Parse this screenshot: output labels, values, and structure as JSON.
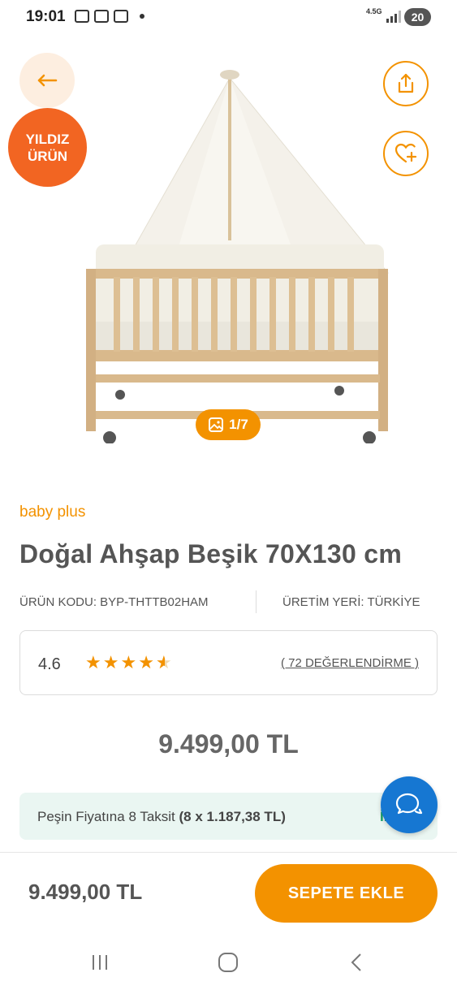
{
  "status_bar": {
    "time": "19:01",
    "network": "4.5G",
    "battery": "20",
    "icons": [
      "pdf-icon",
      "screenshot-icon",
      "box-icon"
    ]
  },
  "hero": {
    "badge_line1": "YILDIZ",
    "badge_line2": "ÜRÜN",
    "gallery_counter": "1/7",
    "icons": {
      "back": "arrow-left-icon",
      "share": "share-icon",
      "favorite": "heart-plus-icon",
      "gallery": "image-icon"
    }
  },
  "product": {
    "brand": "baby plus",
    "title": "Doğal Ahşap Beşik 70X130 cm",
    "code": "ÜRÜN KODU: BYP-THTTB02HAM",
    "origin": "ÜRETİM YERİ: TÜRKİYE",
    "rating": "4.6",
    "rating_value": 4.6,
    "rating_max": 5,
    "reviews": "( 72 DEĞERLENDİRME )",
    "price": "9.499,00 TL"
  },
  "installment": {
    "text": "Peşin Fiyatına 8 Taksit",
    "amount": "(8 x 1.187,38 TL)",
    "link": "İncele"
  },
  "bottom_bar": {
    "price": "9.499,00 TL",
    "add_to_cart": "SEPETE EKLE"
  },
  "colors": {
    "accent": "#f39200",
    "badge": "#f26522",
    "installment_bg": "#eaf6f2",
    "link_green": "#1aa36b",
    "chat_blue": "#1677d2"
  }
}
